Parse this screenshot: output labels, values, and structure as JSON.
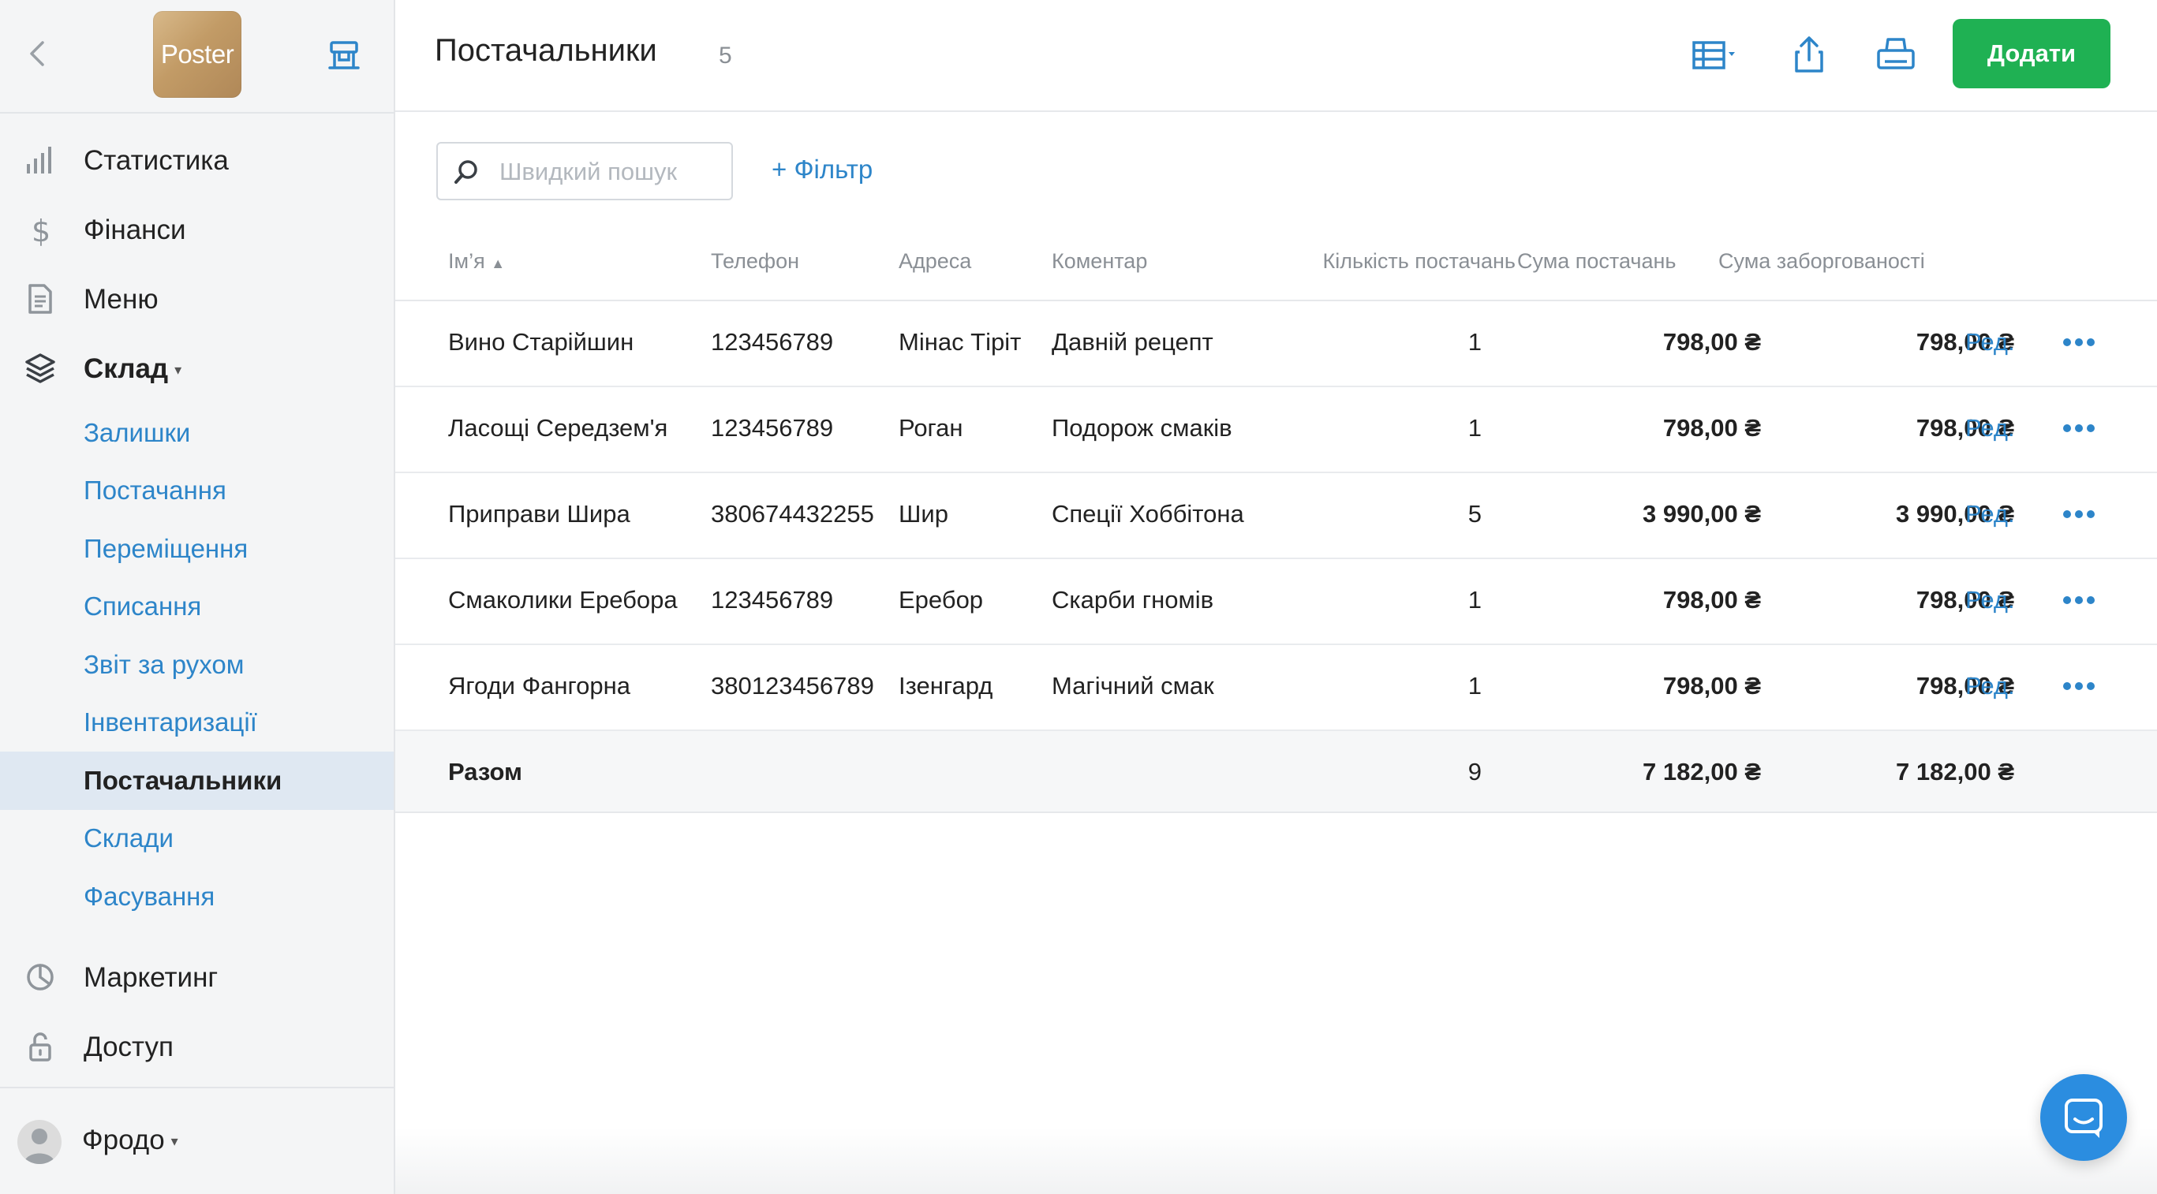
{
  "sidebar": {
    "logo_text": "Poster",
    "nav": [
      {
        "label": "Статистика",
        "icon": "bar-chart-icon"
      },
      {
        "label": "Фінанси",
        "icon": "dollar-icon"
      },
      {
        "label": "Меню",
        "icon": "document-icon"
      },
      {
        "label": "Склад",
        "icon": "layers-icon"
      }
    ],
    "sub_items": [
      {
        "label": "Залишки"
      },
      {
        "label": "Постачання"
      },
      {
        "label": "Переміщення"
      },
      {
        "label": "Списання"
      },
      {
        "label": "Звіт за рухом"
      },
      {
        "label": "Інвентаризації"
      },
      {
        "label": "Постачальники",
        "active": true
      },
      {
        "label": "Склади"
      },
      {
        "label": "Фасування"
      }
    ],
    "nav_bottom": [
      {
        "label": "Маркетинг",
        "icon": "pie-chart-icon"
      },
      {
        "label": "Доступ",
        "icon": "lock-icon"
      }
    ],
    "user_name": "Фродо"
  },
  "header": {
    "title": "Постачальники",
    "count": "5",
    "add_label": "Додати"
  },
  "toolbar": {
    "search_placeholder": "Швидкий пошук",
    "filter_label": "+ Фільтр"
  },
  "table": {
    "columns": [
      "Ім’я",
      "Телефон",
      "Адреса",
      "Коментар",
      "Кількість постачань",
      "Сума постачань",
      "Сума заборгованості"
    ],
    "rows": [
      {
        "name": "Вино Старійшин",
        "phone": "123456789",
        "address": "Мінас Тіріт",
        "comment": "Давній рецепт",
        "qty": "1",
        "sum": "798,00 ₴",
        "debt": "798,00 ₴",
        "edit": "Ред."
      },
      {
        "name": "Ласощі Середзем'я",
        "phone": "123456789",
        "address": "Роган",
        "comment": "Подорож смаків",
        "qty": "1",
        "sum": "798,00 ₴",
        "debt": "798,00 ₴",
        "edit": "Ред."
      },
      {
        "name": "Приправи Шира",
        "phone": "380674432255",
        "address": "Шир",
        "comment": "Спеції Хоббітона",
        "qty": "5",
        "sum": "3 990,00 ₴",
        "debt": "3 990,00 ₴",
        "edit": "Ред."
      },
      {
        "name": "Смаколики Еребора",
        "phone": "123456789",
        "address": "Еребор",
        "comment": "Скарби гномів",
        "qty": "1",
        "sum": "798,00 ₴",
        "debt": "798,00 ₴",
        "edit": "Ред."
      },
      {
        "name": "Ягоди Фангорна",
        "phone": "380123456789",
        "address": "Ізенгард",
        "comment": "Магічний смак",
        "qty": "1",
        "sum": "798,00 ₴",
        "debt": "798,00 ₴",
        "edit": "Ред."
      }
    ],
    "total": {
      "label": "Разом",
      "qty": "9",
      "sum": "7 182,00 ₴",
      "debt": "7 182,00 ₴"
    }
  },
  "colors": {
    "accent_blue": "#2d85c9",
    "add_green": "#1fb153",
    "chat_blue": "#2b8de0"
  }
}
